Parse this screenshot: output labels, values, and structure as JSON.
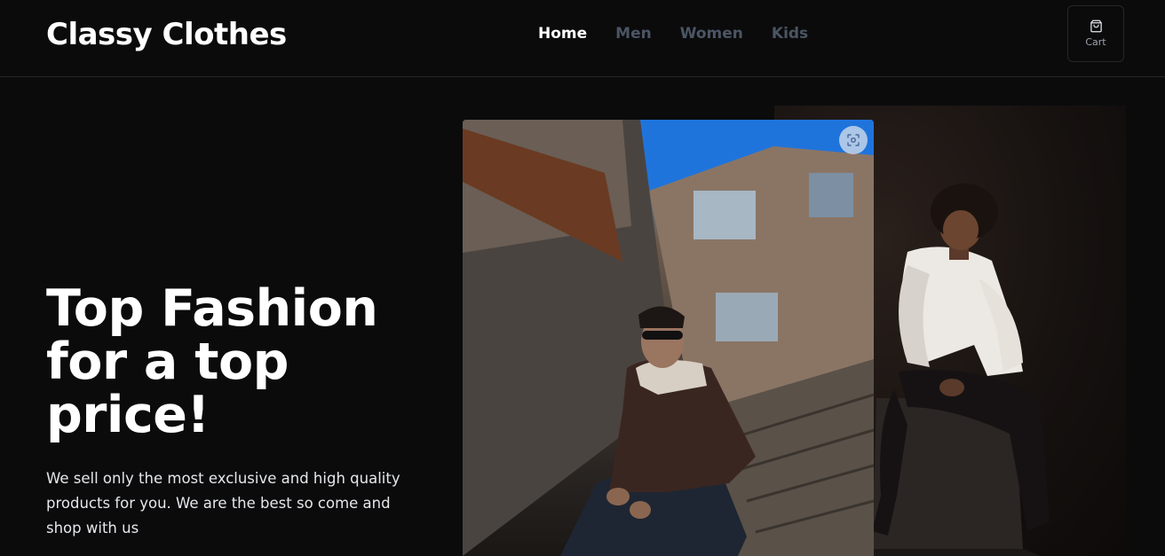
{
  "header": {
    "brand": "Classy Clothes",
    "nav": [
      {
        "label": "Home",
        "active": true
      },
      {
        "label": "Men",
        "active": false
      },
      {
        "label": "Women",
        "active": false
      },
      {
        "label": "Kids",
        "active": false
      }
    ],
    "cart": {
      "label": "Cart",
      "icon": "shopping-bag-icon"
    }
  },
  "hero": {
    "title": "Top Fashion for a top price!",
    "description": "We sell only the most exclusive and high quality products for you. We are the best so come and shop with us"
  },
  "images": {
    "front_icon": "image-search-icon"
  },
  "colors": {
    "background": "#0b0b0c",
    "nav_inactive": "#4b5563",
    "nav_active": "#ffffff"
  }
}
